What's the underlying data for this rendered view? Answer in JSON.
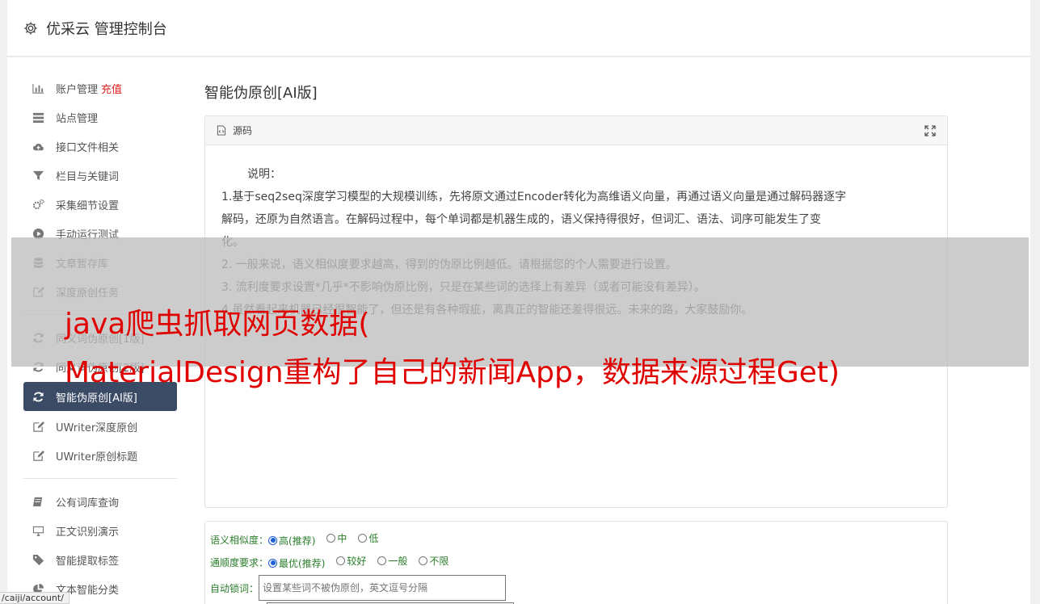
{
  "header": {
    "title": "优采云 管理控制台"
  },
  "sidebar": {
    "group1": [
      {
        "label": "账户管理",
        "extra": "充值",
        "icon": "bar-chart-icon"
      },
      {
        "label": "站点管理",
        "icon": "server-icon"
      },
      {
        "label": "接口文件相关",
        "icon": "cloud-upload-icon"
      },
      {
        "label": "栏目与关键词",
        "icon": "filter-icon"
      },
      {
        "label": "采集细节设置",
        "icon": "cogs-icon"
      },
      {
        "label": "手动运行测试",
        "icon": "play-circle-icon"
      },
      {
        "label": "文章暂存库",
        "icon": "database-icon"
      },
      {
        "label": "深度原创任务",
        "icon": "edit-icon"
      }
    ],
    "group2": [
      {
        "label": "同义词伪原创[1版]",
        "icon": "refresh-icon"
      },
      {
        "label": "同义词伪原创[2版]",
        "icon": "refresh-icon"
      },
      {
        "label": "智能伪原创[AI版]",
        "icon": "refresh-icon",
        "active": true
      },
      {
        "label": "UWriter深度原创",
        "icon": "edit-icon"
      },
      {
        "label": "UWriter原创标题",
        "icon": "edit-icon"
      }
    ],
    "group3": [
      {
        "label": "公有词库查询",
        "icon": "book-icon"
      },
      {
        "label": "正文识别演示",
        "icon": "monitor-icon"
      },
      {
        "label": "智能提取标签",
        "icon": "tag-icon"
      },
      {
        "label": "文本智能分类",
        "icon": "pie-chart-icon"
      }
    ]
  },
  "main": {
    "title": "智能伪原创[AI版]",
    "editor": {
      "source_label": "源码",
      "heading": "说明：",
      "lines": [
        "1.基于seq2seq深度学习模型的大规模训练，先将原文通过Encoder转化为高维语义向量，再通过语义向量是通过解码器逐字",
        "解码，还原为自然语言。在解码过程中，每个单词都是机器生成的，语义保持得很好，但词汇、语法、词序可能发生了变",
        "化。",
        "2. 一般来说，语义相似度要求越高，得到的伪原比例越低。请根据您的个人需要进行设置。",
        "3. 流利度要求设置*几乎*不影响伪原比例，只是在某些词的选择上有差异（或者可能没有差异）。",
        "4.虽然看起来机器已经很智能了，但还是有各种瑕疵，离真正的智能还差得很远。未来的路，大家鼓励你。"
      ]
    },
    "options": {
      "similarity": {
        "label": "语义相似度：",
        "choices": [
          "高(推荐)",
          "中",
          "低"
        ],
        "selected": 0
      },
      "fluency": {
        "label": "通顺度要求：",
        "choices": [
          "最优(推荐)",
          "较好",
          "一般",
          "不限"
        ],
        "selected": 0
      },
      "lock": {
        "label": "自动锁词：",
        "placeholder": "设置某些词不被伪原创，英文逗号分隔"
      }
    }
  },
  "overlay": {
    "line1": "java爬虫抓取网页数据(",
    "line2": "MaterialDesign重构了自己的新闻App，数据来源过程Get)"
  },
  "statusbar": {
    "url": "/caiji/account/"
  },
  "colors": {
    "active_nav": "#3b4b66",
    "accent_red": "#e02020",
    "option_green": "#2a7d2a",
    "headline_red": "#e00000"
  }
}
